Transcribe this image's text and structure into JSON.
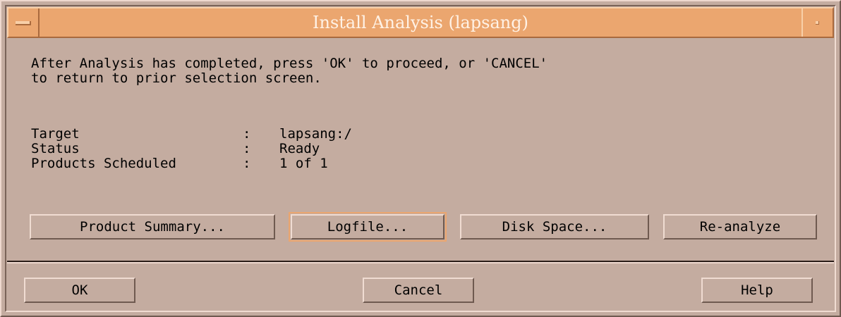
{
  "window": {
    "title": "Install Analysis (lapsang)"
  },
  "message": {
    "line1": "After Analysis has completed, press 'OK' to proceed, or 'CANCEL'",
    "line2": "to return to prior selection screen."
  },
  "info": {
    "target_label": "Target",
    "target_value": "lapsang:/",
    "status_label": "Status",
    "status_value": "Ready",
    "products_label": "Products Scheduled",
    "products_value": "1 of 1",
    "separator": ":"
  },
  "actions": {
    "product_summary": "Product Summary...",
    "logfile": "Logfile...",
    "disk_space": "Disk Space...",
    "reanalyze": "Re-analyze"
  },
  "footer": {
    "ok": "OK",
    "cancel": "Cancel",
    "help": "Help"
  },
  "colors": {
    "titlebar": "#eba66f",
    "background": "#c4aca0"
  }
}
